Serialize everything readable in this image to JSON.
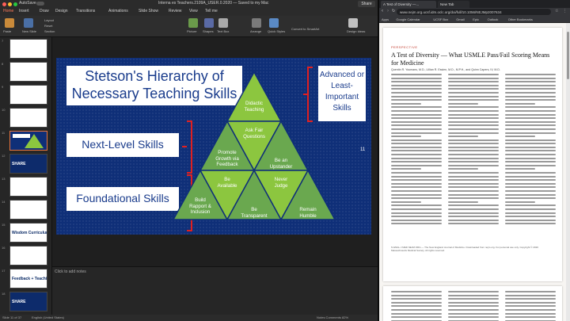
{
  "ppt": {
    "autosave_label": "AutoSave",
    "doc_title": "Interna es Teachers.2109A_USER.0.2020 — Saved to my Mac",
    "share_label": "Share",
    "ribbon_tabs": [
      "Home",
      "Insert",
      "Draw",
      "Design",
      "Transitions",
      "Animations",
      "Slide Show",
      "Review",
      "View",
      "Tell me"
    ],
    "ribbon_buttons": [
      {
        "label": "Paste",
        "color": "#c98a3a"
      },
      {
        "label": "New Slide",
        "color": "#4a6fa5"
      },
      {
        "label": "Picture",
        "color": "#6a9a4a"
      },
      {
        "label": "Shapes",
        "color": "#5a6aa5"
      },
      {
        "label": "Text Box",
        "color": "#aaaaaa"
      },
      {
        "label": "Arrange",
        "color": "#7a7a7a"
      },
      {
        "label": "Quick Styles",
        "color": "#5a8ac5"
      },
      {
        "label": "Design Ideas",
        "color": "#c0c0c0"
      }
    ],
    "ribbon_small": [
      "Layout",
      "Reset",
      "Section",
      "Convert to SmartArt"
    ],
    "thumbnails": [
      {
        "num": "7",
        "label": "",
        "dark": false
      },
      {
        "num": "8",
        "label": "",
        "dark": false
      },
      {
        "num": "9",
        "label": "",
        "dark": false
      },
      {
        "num": "10",
        "label": "",
        "dark": false
      },
      {
        "num": "11",
        "label": "",
        "dark": false,
        "selected": true
      },
      {
        "num": "12",
        "label": "SHARE",
        "dark": true
      },
      {
        "num": "13",
        "label": "",
        "dark": false
      },
      {
        "num": "14",
        "label": "",
        "dark": false
      },
      {
        "num": "15",
        "label": "Wisdom Curriculum",
        "dark": false
      },
      {
        "num": "16",
        "label": "",
        "dark": false
      },
      {
        "num": "17",
        "label": "Feedback + Teaching",
        "dark": false
      },
      {
        "num": "18",
        "label": "SHARE",
        "dark": true
      }
    ],
    "notes_placeholder": "Click to add notes",
    "status_left": "Slide 11 of 37",
    "status_lang": "English (United States)",
    "status_right": "Notes   Comments   82%"
  },
  "slide": {
    "title": "Stetson's Hierarchy of Necessary Teaching Skills",
    "right_box": "Advanced or Least-Important Skills",
    "next_level": "Next-Level Skills",
    "foundational": "Foundational Skills",
    "slide_number": "11",
    "triangles": [
      {
        "label": "Didactic Teaching"
      },
      {
        "label": "Ask Fair Questions"
      },
      {
        "label": "Promote Growth via Feedback"
      },
      {
        "label": "Be an Upstander"
      },
      {
        "label": "Be Available"
      },
      {
        "label": "Never Judge"
      },
      {
        "label": "Build Rapport & Inclusion"
      },
      {
        "label": "Be Transparent"
      },
      {
        "label": "Remain Humble"
      }
    ],
    "colors": {
      "background": "#0f2f78",
      "tri_light": "#8cc63f",
      "tri_mid": "#6aa84f",
      "tri_dark": "#4e8a3a",
      "bracket": "#e02020"
    }
  },
  "browser": {
    "tabs": [
      {
        "title": "A Test of Diversity —..."
      },
      {
        "title": "New Tab"
      }
    ],
    "url": "www.nejm.org.ucsf.idm.oclc.org/doi/full/10.1056/NEJMp2007634",
    "bookmarks": [
      "Apps",
      "Google Calendar",
      "UCSF Box",
      "Gmail",
      "Epic",
      "Outlook",
      "Other Bookmarks"
    ],
    "article": {
      "section": "PERSPECTIVE",
      "title": "A Test of Diversity — What USMLE Pass/Fail Scoring Means for Medicine",
      "authors": "Quentin R. Youmans, M.D., Lillian R. Essien, M.D., M.P.H., and Quinn Capers, IV, M.D.",
      "footer": "N ENGL J MED NEJM.ORG — The New England Journal of Medicine. Downloaded from nejm.org. For personal use only. Copyright © 2020 Massachusetts Medical Society. All rights reserved."
    }
  }
}
